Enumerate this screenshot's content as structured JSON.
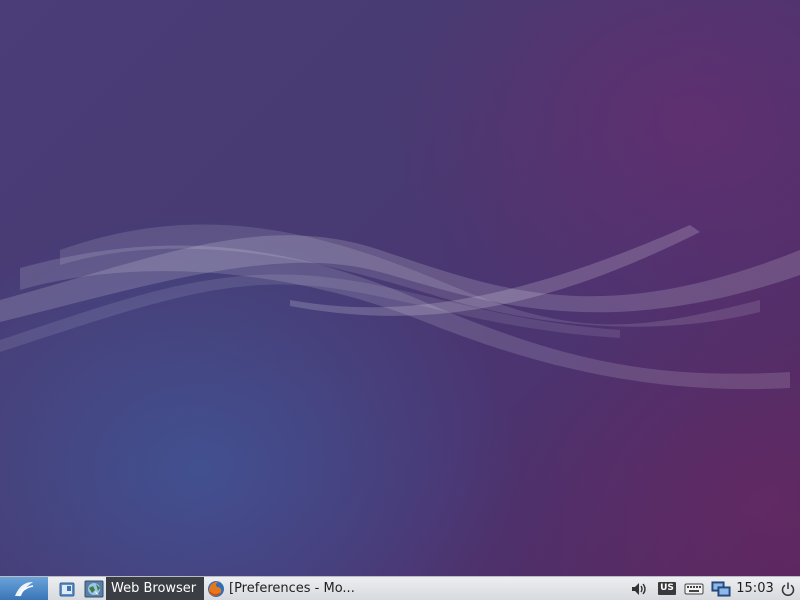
{
  "desktop": {
    "wallpaper": "lubuntu-default-waves",
    "colors": {
      "base": "#4a3d78",
      "blue_glow": "#3c64aa",
      "magenta": "#55285f"
    }
  },
  "taskbar": {
    "menu_icon": "lubuntu-menu-icon",
    "quick_launch": [
      {
        "icon": "file-manager-icon"
      },
      {
        "icon": "web-browser-icon"
      }
    ],
    "active_label": "Web Browser",
    "tasks": [
      {
        "icon": "firefox-icon",
        "title": "[Preferences - Mo..."
      }
    ],
    "tray": {
      "volume_icon": "volume-icon",
      "keyboard_layout": "US",
      "keyboard_icon": "keyboard-icon",
      "network_icon": "network-icon",
      "clock": "15:03",
      "power_icon": "power-icon"
    },
    "colors": {
      "bar": "#dfe2e6",
      "menu_button": "#4a86c6",
      "active_tooltip": "#3b3e44"
    }
  }
}
